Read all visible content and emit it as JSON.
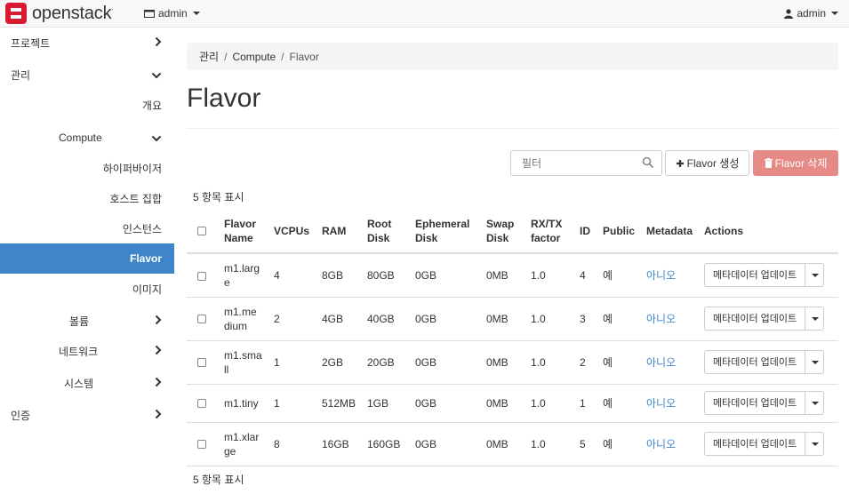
{
  "brand": {
    "name": "openstack",
    "reg": "."
  },
  "topbar": {
    "project": "admin",
    "user": "admin"
  },
  "sidebar": {
    "items": [
      {
        "label": "프로젝트",
        "chevron": "›"
      },
      {
        "label": "관리",
        "chevron": "⌄"
      },
      {
        "label": "개요"
      },
      {
        "label": "Compute",
        "chevron": "⌄"
      },
      {
        "label": "하이퍼바이저"
      },
      {
        "label": "호스트 집합"
      },
      {
        "label": "인스턴스"
      },
      {
        "label": "Flavor"
      },
      {
        "label": "이미지"
      },
      {
        "label": "볼륨",
        "chevron": "›"
      },
      {
        "label": "네트워크",
        "chevron": "›"
      },
      {
        "label": "시스템",
        "chevron": "›"
      },
      {
        "label": "인증",
        "chevron": "›"
      }
    ]
  },
  "breadcrumb": {
    "items": [
      "관리",
      "Compute",
      "Flavor"
    ]
  },
  "page_title": "Flavor",
  "toolbar": {
    "filter_placeholder": "필터",
    "create_label": "Flavor 생성",
    "delete_label": "Flavor 삭제"
  },
  "count_text": "5 항목 표시",
  "table": {
    "headers": {
      "name": [
        "Flavor",
        "Name"
      ],
      "vcpus": "VCPUs",
      "ram": "RAM",
      "root": [
        "Root",
        "Disk"
      ],
      "eph": [
        "Ephemeral",
        "Disk"
      ],
      "swap": [
        "Swap",
        "Disk"
      ],
      "rxtx": [
        "RX/TX",
        "factor"
      ],
      "id": "ID",
      "public": "Public",
      "metadata": "Metadata",
      "actions": "Actions"
    },
    "rows": [
      {
        "name": [
          "m1.larg",
          "e"
        ],
        "vcpus": "4",
        "ram": "8GB",
        "root": "80GB",
        "eph": "0GB",
        "swap": "0MB",
        "rxtx": "1.0",
        "id": "4",
        "public": "예",
        "metadata": "아니오",
        "action": "메타데이터 업데이트"
      },
      {
        "name": [
          "m1.me",
          "dium"
        ],
        "vcpus": "2",
        "ram": "4GB",
        "root": "40GB",
        "eph": "0GB",
        "swap": "0MB",
        "rxtx": "1.0",
        "id": "3",
        "public": "예",
        "metadata": "아니오",
        "action": "메타데이터 업데이트"
      },
      {
        "name": [
          "m1.sma",
          "ll"
        ],
        "vcpus": "1",
        "ram": "2GB",
        "root": "20GB",
        "eph": "0GB",
        "swap": "0MB",
        "rxtx": "1.0",
        "id": "2",
        "public": "예",
        "metadata": "아니오",
        "action": "메타데이터 업데이트"
      },
      {
        "name": [
          "m1.tiny",
          ""
        ],
        "vcpus": "1",
        "ram": "512MB",
        "root": "1GB",
        "eph": "0GB",
        "swap": "0MB",
        "rxtx": "1.0",
        "id": "1",
        "public": "예",
        "metadata": "아니오",
        "action": "메타데이터 업데이트"
      },
      {
        "name": [
          "m1.xlar",
          "ge"
        ],
        "vcpus": "8",
        "ram": "16GB",
        "root": "160GB",
        "eph": "0GB",
        "swap": "0MB",
        "rxtx": "1.0",
        "id": "5",
        "public": "예",
        "metadata": "아니오",
        "action": "메타데이터 업데이트"
      }
    ]
  },
  "colors": {
    "accent": "#3e86c9",
    "danger": "#e68a86",
    "brand": "#da1a32"
  }
}
